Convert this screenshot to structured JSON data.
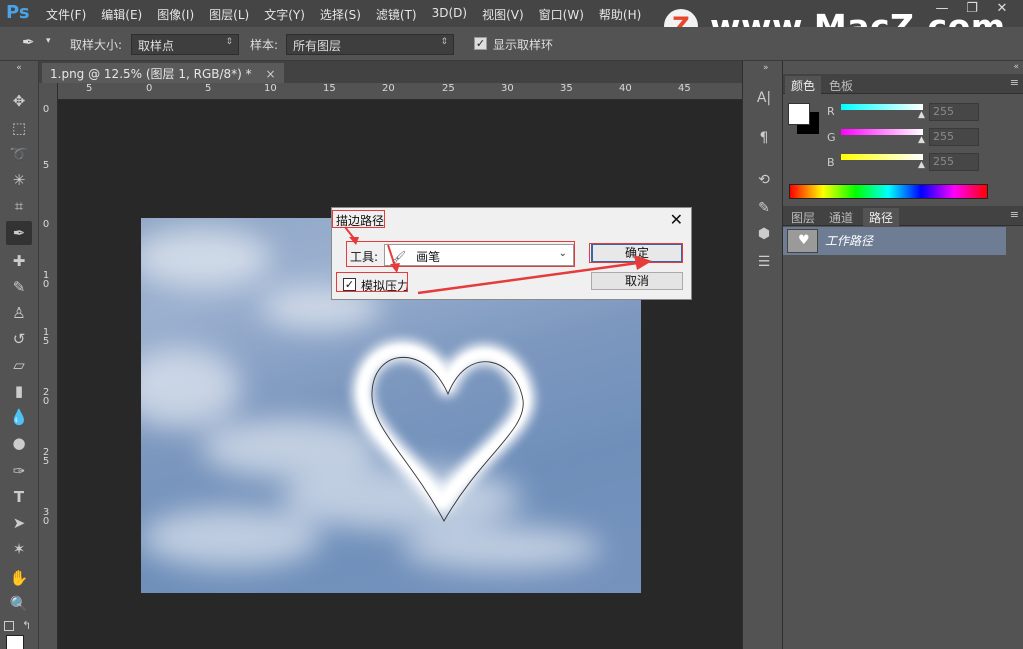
{
  "app": {
    "logo": "Ps"
  },
  "menu": [
    "文件(F)",
    "编辑(E)",
    "图像(I)",
    "图层(L)",
    "文字(Y)",
    "选择(S)",
    "滤镜(T)",
    "3D(D)",
    "视图(V)",
    "窗口(W)",
    "帮助(H)"
  ],
  "watermark": {
    "badge": "Z",
    "text": "www.MacZ.com"
  },
  "window_controls": {
    "minimize": "—",
    "restore": "❐",
    "close": "✕"
  },
  "options": {
    "sample_size_label": "取样大小:",
    "sample_size_value": "取样点",
    "sample_label": "样本:",
    "sample_value": "所有图层",
    "show_ring_label": "显示取样环",
    "show_ring_checked": true
  },
  "document": {
    "tab": "1.png @ 12.5% (图层 1, RGB/8*) *",
    "close": "×"
  },
  "rulers": {
    "h_ticks": [
      "5",
      "0",
      "5",
      "10",
      "15",
      "20",
      "25",
      "30",
      "35",
      "40",
      "45"
    ],
    "v_ticks": [
      "0",
      "5",
      "0",
      "1 0",
      "1 5",
      "2 0",
      "2 5",
      "3 0"
    ]
  },
  "color_panel": {
    "tabs": [
      "颜色",
      "色板"
    ],
    "channels": [
      {
        "label": "R",
        "value": "255",
        "color": "#00e5e5"
      },
      {
        "label": "G",
        "value": "255",
        "color": "#e040e0"
      },
      {
        "label": "B",
        "value": "255",
        "color": "#f0f000"
      }
    ]
  },
  "layers_panel": {
    "tabs": [
      "图层",
      "通道",
      "路径"
    ],
    "active_tab": "路径",
    "path_item": "工作路径"
  },
  "dialog": {
    "title": "描边路径",
    "close": "✕",
    "tool_label": "工具:",
    "tool_value": "画笔",
    "simulate_pressure_label": "模拟压力",
    "simulate_pressure_checked": true,
    "ok": "确定",
    "cancel": "取消"
  },
  "colors": {
    "accent_red": "#e53b3b",
    "selected_path": "#6e7d93"
  }
}
